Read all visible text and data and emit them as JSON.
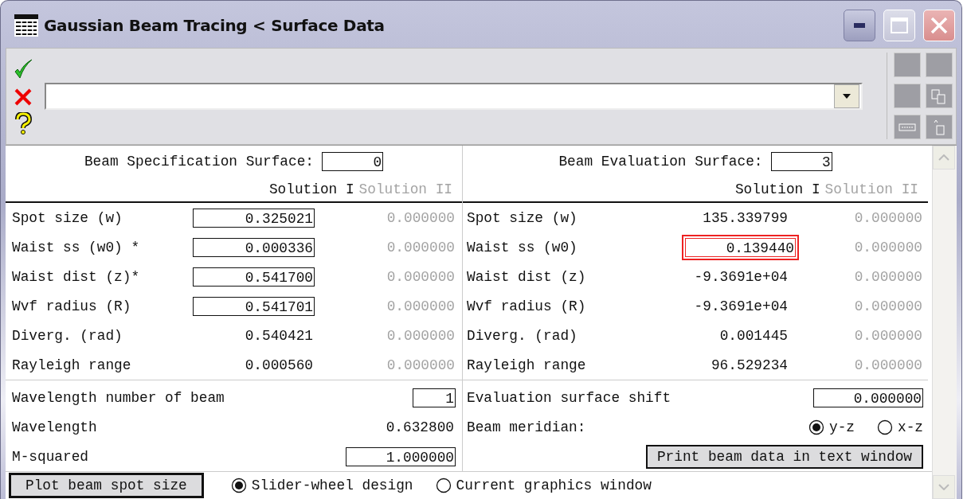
{
  "window": {
    "title": "Gaussian Beam Tracing < Surface Data"
  },
  "spec_surface": {
    "label": "Beam Specification Surface:",
    "value": "0"
  },
  "eval_surface": {
    "label": "Beam Evaluation Surface:",
    "value": "3"
  },
  "left_solutions": [
    {
      "label": "Solution I",
      "disabled": false
    },
    {
      "label": "Solution II",
      "disabled": true
    }
  ],
  "right_solutions": [
    {
      "label": "Solution I",
      "disabled": false
    },
    {
      "label": "Solution II",
      "disabled": true
    }
  ],
  "left_rows": [
    {
      "label": "Spot size (w)",
      "kind": "field",
      "value": "0.325021",
      "value_2": "0.000000"
    },
    {
      "label": "Waist ss (w0) *",
      "kind": "field",
      "value": "0.000336",
      "value_2": "0.000000"
    },
    {
      "label": "Waist dist (z)*",
      "kind": "field",
      "value": "0.541700",
      "value_2": "0.000000"
    },
    {
      "label": "Wvf radius (R)",
      "kind": "field",
      "value": "0.541701",
      "value_2": "0.000000"
    },
    {
      "label": "Diverg. (rad)",
      "kind": "text",
      "value": "0.540421",
      "value_2": "0.000000"
    },
    {
      "label": "Rayleigh range",
      "kind": "text",
      "value": "0.000560",
      "value_2": "0.000000"
    }
  ],
  "right_rows": [
    {
      "label": "Spot size (w)",
      "kind": "text",
      "highlighted": false,
      "value": "135.339799",
      "value_2": "0.000000"
    },
    {
      "label": "Waist ss (w0)",
      "kind": "field",
      "highlighted": true,
      "value": "0.139440",
      "value_2": "0.000000"
    },
    {
      "label": "Waist dist (z)",
      "kind": "text",
      "highlighted": false,
      "value": "-9.3691e+04",
      "value_2": "0.000000"
    },
    {
      "label": "Wvf radius (R)",
      "kind": "text",
      "highlighted": false,
      "value": "-9.3691e+04",
      "value_2": "0.000000"
    },
    {
      "label": "Diverg. (rad)",
      "kind": "text",
      "highlighted": false,
      "value": "0.001445",
      "value_2": "0.000000"
    },
    {
      "label": "Rayleigh range",
      "kind": "text",
      "highlighted": false,
      "value": "96.529234",
      "value_2": "0.000000"
    }
  ],
  "left_settings": [
    {
      "label": "Wavelength number of beam",
      "kind": "small-field",
      "value": "1"
    },
    {
      "label": "Wavelength",
      "kind": "text",
      "value": "0.632800"
    },
    {
      "label": "M-squared",
      "kind": "field",
      "value": "1.000000"
    }
  ],
  "evaluation_shift": {
    "label": "Evaluation surface shift",
    "value": "0.000000"
  },
  "beam_meridian": {
    "label": "Beam meridian:",
    "options": [
      {
        "label": "y-z",
        "selected": true
      },
      {
        "label": "x-z",
        "selected": false
      }
    ]
  },
  "print_button": "Print beam data in text window",
  "plot_button": "Plot beam spot size",
  "plot_target": [
    {
      "label": "Slider-wheel design",
      "selected": true
    },
    {
      "label": "Current graphics window",
      "selected": false
    }
  ]
}
